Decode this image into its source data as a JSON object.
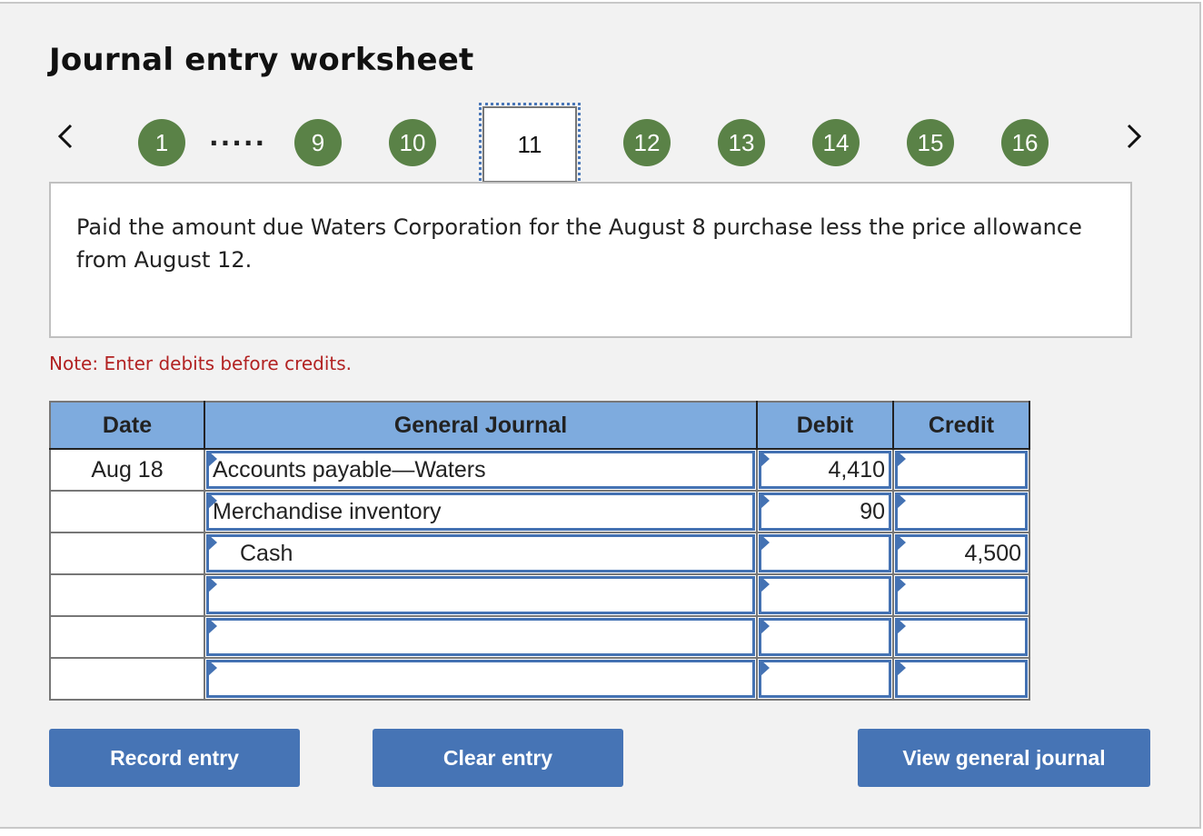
{
  "header": {
    "title": "Journal entry worksheet"
  },
  "pager": {
    "prev_label": "<",
    "next_label": ">",
    "ellipsis": ".....",
    "steps": [
      "1",
      "9",
      "10",
      "11",
      "12",
      "13",
      "14",
      "15",
      "16"
    ],
    "active_step": "11",
    "completed_color": "#5a8247"
  },
  "prompt": {
    "text": "Paid the amount due Waters Corporation for the August 8 purchase less the price allowance from August 12."
  },
  "note": {
    "text": "Note: Enter debits before credits."
  },
  "journal": {
    "columns": [
      "Date",
      "General Journal",
      "Debit",
      "Credit"
    ],
    "rows": [
      {
        "date": "Aug 18",
        "account": "Accounts payable—Waters",
        "debit": "4,410",
        "credit": ""
      },
      {
        "date": "",
        "account": "Merchandise inventory",
        "debit": "90",
        "credit": ""
      },
      {
        "date": "",
        "account": "Cash",
        "debit": "",
        "credit": "4,500"
      },
      {
        "date": "",
        "account": "",
        "debit": "",
        "credit": ""
      },
      {
        "date": "",
        "account": "",
        "debit": "",
        "credit": ""
      },
      {
        "date": "",
        "account": "",
        "debit": "",
        "credit": ""
      }
    ]
  },
  "buttons": {
    "record": "Record entry",
    "clear": "Clear entry",
    "view": "View general journal"
  },
  "colors": {
    "header_bg": "#7eabde",
    "button_bg": "#4674b5",
    "note": "#b22222",
    "input_border": "#4472b3"
  }
}
